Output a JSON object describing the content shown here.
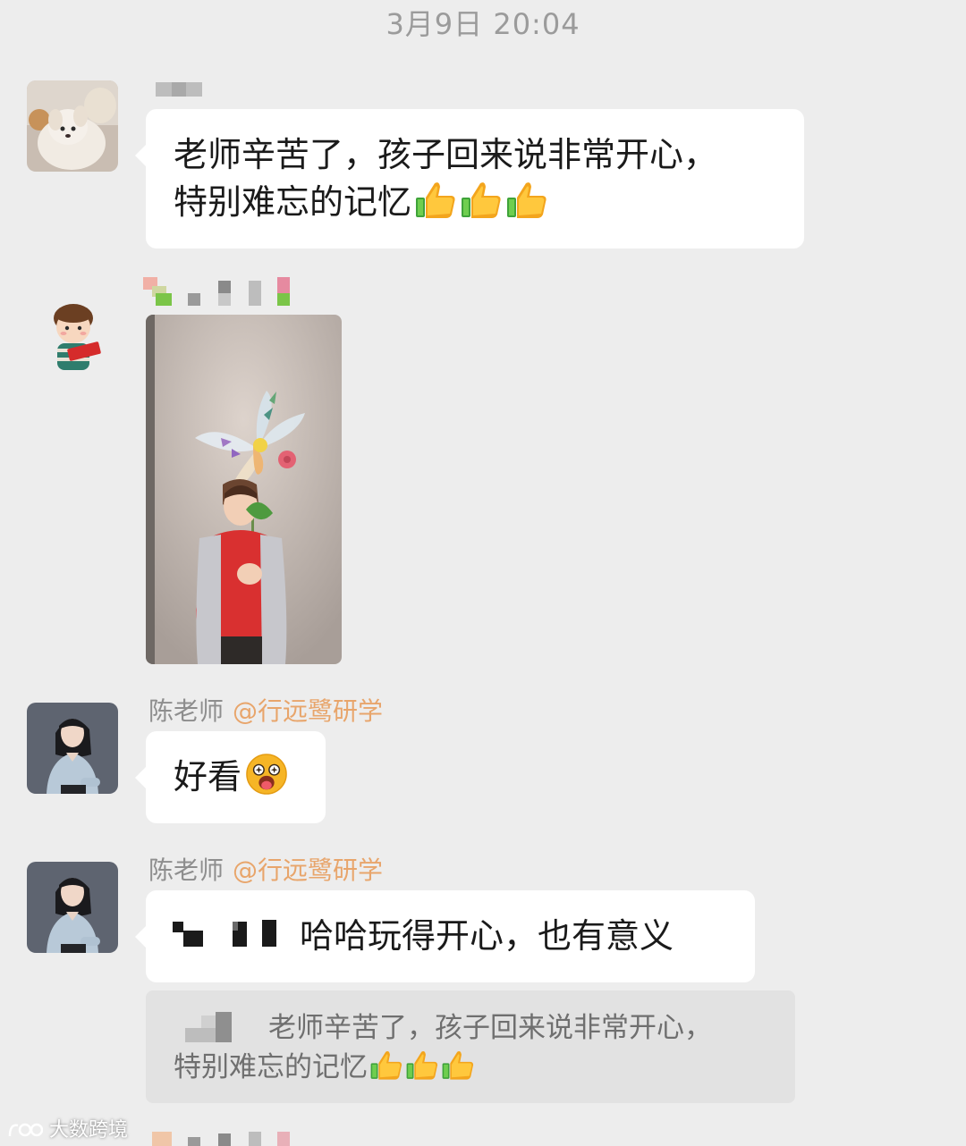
{
  "timestamp": "3月9日 20:04",
  "messages": [
    {
      "text_line1": "老师辛苦了，孩子回来说非常开心，",
      "text_line2": "特别难忘的记忆",
      "emoji": "thumbs-up-icon"
    },
    {
      "content": "photo",
      "description_icon": "child-with-paper-flower-photo"
    },
    {
      "sender": "陈老师",
      "sender_tag": "@行远鹭研学",
      "text": "好看",
      "emoji": "starstruck-face-icon"
    },
    {
      "sender": "陈老师",
      "sender_tag": "@行远鹭研学",
      "text": "哈哈玩得开心，也有意义",
      "quote_line1": "老师辛苦了，孩子回来说非常开心，",
      "quote_line2": "特别难忘的记忆"
    }
  ],
  "watermark": "大数跨境",
  "colors": {
    "background": "#ededed",
    "bubble": "#ffffff",
    "quote": "#e2e2e2",
    "sender_tag": "#e8a56b"
  }
}
